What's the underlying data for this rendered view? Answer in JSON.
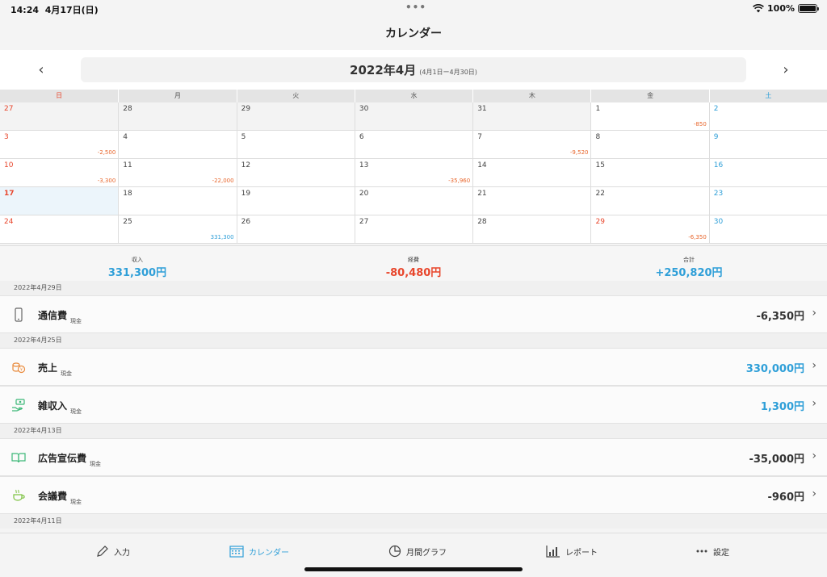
{
  "status": {
    "time": "14:24",
    "date": "4月17日(日)",
    "battery": "100%"
  },
  "nav": {
    "title": "カレンダー"
  },
  "month": {
    "label": "2022年4月",
    "range": "(4月1日ー4月30日)"
  },
  "weekdays": [
    "日",
    "月",
    "火",
    "水",
    "木",
    "金",
    "土"
  ],
  "calendar": [
    [
      {
        "d": "27",
        "a": "",
        "o": true
      },
      {
        "d": "28",
        "a": "",
        "o": true
      },
      {
        "d": "29",
        "a": "",
        "o": true
      },
      {
        "d": "30",
        "a": "",
        "o": true
      },
      {
        "d": "31",
        "a": "",
        "o": true
      },
      {
        "d": "1",
        "a": "-850"
      },
      {
        "d": "2",
        "a": ""
      }
    ],
    [
      {
        "d": "3",
        "a": "-2,500"
      },
      {
        "d": "4",
        "a": ""
      },
      {
        "d": "5",
        "a": ""
      },
      {
        "d": "6",
        "a": ""
      },
      {
        "d": "7",
        "a": "-9,520"
      },
      {
        "d": "8",
        "a": ""
      },
      {
        "d": "9",
        "a": ""
      }
    ],
    [
      {
        "d": "10",
        "a": "-3,300"
      },
      {
        "d": "11",
        "a": "-22,000"
      },
      {
        "d": "12",
        "a": ""
      },
      {
        "d": "13",
        "a": "-35,960"
      },
      {
        "d": "14",
        "a": ""
      },
      {
        "d": "15",
        "a": ""
      },
      {
        "d": "16",
        "a": ""
      }
    ],
    [
      {
        "d": "17",
        "a": "",
        "today": true
      },
      {
        "d": "18",
        "a": ""
      },
      {
        "d": "19",
        "a": ""
      },
      {
        "d": "20",
        "a": ""
      },
      {
        "d": "21",
        "a": ""
      },
      {
        "d": "22",
        "a": ""
      },
      {
        "d": "23",
        "a": ""
      }
    ],
    [
      {
        "d": "24",
        "a": ""
      },
      {
        "d": "25",
        "a": "331,300",
        "plus": true
      },
      {
        "d": "26",
        "a": ""
      },
      {
        "d": "27",
        "a": ""
      },
      {
        "d": "28",
        "a": ""
      },
      {
        "d": "29",
        "a": "-6,350",
        "holiday": true
      },
      {
        "d": "30",
        "a": ""
      }
    ]
  ],
  "summary": {
    "income_label": "収入",
    "income_value": "331,300円",
    "expense_label": "経費",
    "expense_value": "-80,480円",
    "total_label": "合計",
    "total_value": "+250,820円"
  },
  "groups": [
    {
      "date": "2022年4月29日",
      "items": [
        {
          "name": "通信費",
          "method": "現金",
          "amount": "-6,350円",
          "plus": false,
          "icon": "phone-icon"
        }
      ]
    },
    {
      "date": "2022年4月25日",
      "items": [
        {
          "name": "売上",
          "method": "現金",
          "amount": "330,000円",
          "plus": true,
          "icon": "coins-icon"
        },
        {
          "name": "雑収入",
          "method": "現金",
          "amount": "1,300円",
          "plus": true,
          "icon": "hand-money-icon"
        }
      ]
    },
    {
      "date": "2022年4月13日",
      "items": [
        {
          "name": "広告宣伝費",
          "method": "現金",
          "amount": "-35,000円",
          "plus": false,
          "icon": "open-book-icon"
        },
        {
          "name": "会議費",
          "method": "現金",
          "amount": "-960円",
          "plus": false,
          "icon": "coffee-cup-icon"
        }
      ]
    },
    {
      "date": "2022年4月11日",
      "items": []
    }
  ],
  "tabs": [
    {
      "label": "入力",
      "icon": "pencil-icon",
      "active": false
    },
    {
      "label": "カレンダー",
      "icon": "calendar-icon",
      "active": true
    },
    {
      "label": "月間グラフ",
      "icon": "pie-chart-icon",
      "active": false
    },
    {
      "label": "レポート",
      "icon": "bar-report-icon",
      "active": false
    },
    {
      "label": "設定",
      "icon": "more-dots-icon",
      "active": false
    }
  ],
  "colors": {
    "accent": "#2f9fd8",
    "negative": "#e8462c",
    "amount_negative": "#e8662c"
  }
}
